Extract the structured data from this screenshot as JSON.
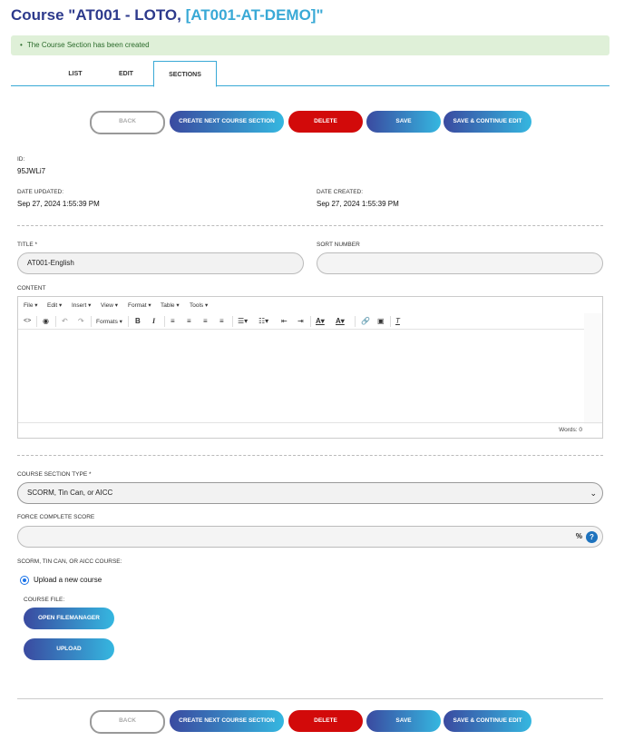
{
  "title": {
    "prefix": "Course \"AT001 - LOTO, ",
    "course_code": "[AT001-AT-DEMO]",
    "suffix": "\""
  },
  "alert": {
    "bullet": "•",
    "message": "The Course Section has been created",
    "color": "#dff0d8"
  },
  "tabs": [
    {
      "label": "LIST"
    },
    {
      "label": "EDIT"
    },
    {
      "label": "SECTIONS",
      "active": true
    }
  ],
  "actions": {
    "back": "BACK",
    "create_next": "CREATE NEXT COURSE SECTION",
    "delete": "DELETE",
    "save": "SAVE",
    "save_continue": "SAVE & CONTINUE EDIT"
  },
  "meta": {
    "id_label": "ID:",
    "id_value": "95JWLi7",
    "date_updated_label": "DATE UPDATED:",
    "date_updated_value": "Sep 27, 2024 1:55:39 PM",
    "date_created_label": "DATE CREATED:",
    "date_created_value": "Sep 27, 2024 1:55:39 PM"
  },
  "form": {
    "title_label": "TITLE *",
    "title_value": "AT001-English",
    "sort_label": "SORT NUMBER",
    "sort_value": "",
    "content_label": "CONTENT",
    "section_type_label": "COURSE SECTION TYPE *",
    "section_type_value": "SCORM, Tin Can, or AICC",
    "force_score_label": "FORCE COMPLETE SCORE",
    "force_score_value": "",
    "percent": "%",
    "help": "?",
    "scorm_label": "SCORM, TIN CAN, OR AICC COURSE:",
    "upload_option": "Upload a new course",
    "course_file_label": "COURSE FILE:",
    "open_filemanager": "OPEN FILEMANAGER",
    "upload": "UPLOAD"
  },
  "editor": {
    "menus": [
      "File",
      "Edit",
      "Insert",
      "View",
      "Format",
      "Table",
      "Tools"
    ],
    "formats_label": "Formats",
    "words": "Words: 0"
  },
  "colors": {
    "brand_dark": "#2d3a8c",
    "brand_light": "#39a9d6",
    "danger": "#d20a0a"
  }
}
